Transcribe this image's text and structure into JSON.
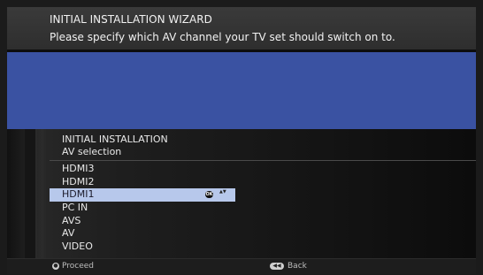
{
  "banner": {
    "title": "INITIAL INSTALLATION WIZARD",
    "instruction": "Please specify which AV channel your TV set should switch on to."
  },
  "menu": {
    "title": "INITIAL INSTALLATION",
    "subtitle": "AV selection",
    "items": [
      {
        "label": "HDMI3",
        "selected": false
      },
      {
        "label": "HDMI2",
        "selected": false
      },
      {
        "label": "HDMI1",
        "selected": true
      },
      {
        "label": "PC IN",
        "selected": false
      },
      {
        "label": "AVS",
        "selected": false
      },
      {
        "label": "AV",
        "selected": false
      },
      {
        "label": "VIDEO",
        "selected": false
      }
    ],
    "ok_icon": {
      "name": "ok-button-icon",
      "glyph": "OK"
    },
    "updown_icon": {
      "name": "up-down-arrows-icon",
      "glyph": "▲▼"
    }
  },
  "footer": {
    "proceed_label": "Proceed",
    "proceed_icon": {
      "name": "ok-button-icon",
      "glyph": "●"
    },
    "back_label": "Back",
    "back_icon": {
      "name": "back-button-icon",
      "glyph": "◀◀"
    }
  },
  "colors": {
    "banner_bg": "#333333",
    "blue_band": "#3a52a2",
    "selection": "#b7c8eb",
    "text": "#e9e9e9"
  }
}
